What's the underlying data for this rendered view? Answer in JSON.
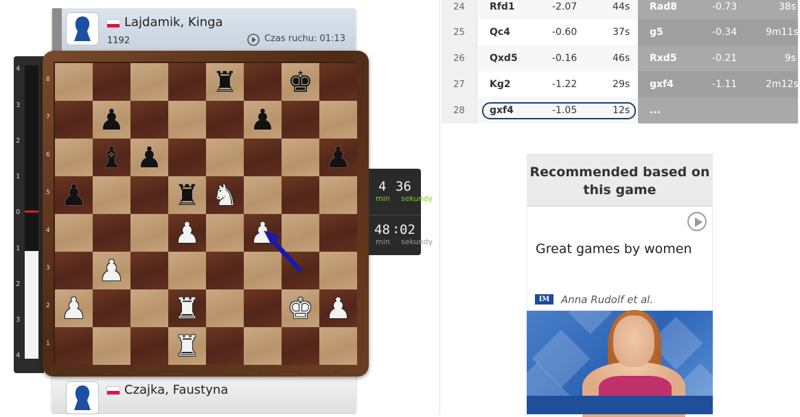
{
  "top_player": {
    "name": "Lajdamik, Kinga",
    "rating": "1192",
    "move_time": "Czas ruchu: 01:13",
    "flag_colors": [
      "#ffffff",
      "#dc143c"
    ]
  },
  "bottom_player": {
    "name": "Czajka, Faustyna",
    "flag_colors": [
      "#ffffff",
      "#dc143c"
    ]
  },
  "eval_bar": {
    "ticks_top": [
      "4",
      "3",
      "2",
      "1",
      "0"
    ],
    "ticks_bottom": [
      "1",
      "2",
      "3",
      "4"
    ],
    "marker_color": "#e02020"
  },
  "board": {
    "ranks": [
      "8",
      "7",
      "6",
      "5",
      "4",
      "3",
      "2",
      "1"
    ],
    "files": [
      "A",
      "B",
      "C",
      "D",
      "E",
      "F",
      "G",
      "H"
    ],
    "pieces": [
      {
        "square": "e8",
        "glyph": "♜",
        "color": "b"
      },
      {
        "square": "g8",
        "glyph": "♚",
        "color": "b"
      },
      {
        "square": "b7",
        "glyph": "♟",
        "color": "b"
      },
      {
        "square": "f7",
        "glyph": "♟",
        "color": "b"
      },
      {
        "square": "b6",
        "glyph": "♝",
        "color": "b"
      },
      {
        "square": "c6",
        "glyph": "♟",
        "color": "b"
      },
      {
        "square": "h6",
        "glyph": "♟",
        "color": "b"
      },
      {
        "square": "a5",
        "glyph": "♟",
        "color": "b"
      },
      {
        "square": "d5",
        "glyph": "♜",
        "color": "b"
      },
      {
        "square": "e5",
        "glyph": "♞",
        "color": "w"
      },
      {
        "square": "d4",
        "glyph": "♟",
        "color": "w"
      },
      {
        "square": "f4",
        "glyph": "♟",
        "color": "w"
      },
      {
        "square": "b3",
        "glyph": "♟",
        "color": "w"
      },
      {
        "square": "a2",
        "glyph": "♟",
        "color": "w"
      },
      {
        "square": "d2",
        "glyph": "♜",
        "color": "w"
      },
      {
        "square": "g2",
        "glyph": "♚",
        "color": "w"
      },
      {
        "square": "h2",
        "glyph": "♟",
        "color": "w"
      },
      {
        "square": "d1",
        "glyph": "♜",
        "color": "w"
      }
    ],
    "arrow": {
      "from": "g3",
      "to": "f4",
      "color": "#1a1aa8"
    }
  },
  "clocks": {
    "top": {
      "min": "4",
      "sec": "36",
      "min_label": "min",
      "sec_label": "sekundy",
      "min_color": "#7cd321",
      "sec_color": "#7cd321"
    },
    "bottom": {
      "min": "48",
      "sec": "02",
      "sep": ":",
      "min_label": "min",
      "sec_label": "sekundy",
      "label_color": "#9a9a9a"
    }
  },
  "moves": [
    {
      "num": "24",
      "white": "Rfd1",
      "white_eval": "-2.07",
      "white_time": "44s",
      "black": "Rad8",
      "black_eval": "-0.73",
      "black_time": "38s"
    },
    {
      "num": "25",
      "white": "Qc4",
      "white_eval": "-0.60",
      "white_time": "37s",
      "black": "g5",
      "black_eval": "-0.34",
      "black_time": "9m11s"
    },
    {
      "num": "26",
      "white": "Qxd5",
      "white_eval": "-0.16",
      "white_time": "46s",
      "black": "Rxd5",
      "black_eval": "-0.21",
      "black_time": "9s"
    },
    {
      "num": "27",
      "white": "Kg2",
      "white_eval": "-1.22",
      "white_time": "29s",
      "black": "gxf4",
      "black_eval": "-1.11",
      "black_time": "2m12s"
    },
    {
      "num": "28",
      "white": "gxf4",
      "white_eval": "-1.05",
      "white_time": "12s",
      "black": "...",
      "black_eval": "",
      "black_time": ""
    }
  ],
  "recommended": {
    "header": "Recommended based on this game",
    "title": "Great games by women",
    "badge": "IM",
    "author": "Anna Rudolf et al.",
    "icon": "play-icon"
  }
}
